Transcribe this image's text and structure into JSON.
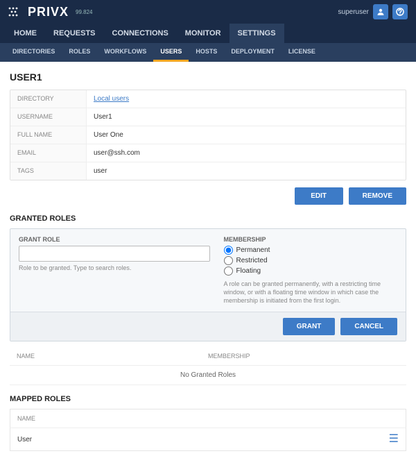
{
  "brand": {
    "name": "PRIVX",
    "version": "99.824"
  },
  "user_menu": {
    "username": "superuser"
  },
  "nav_primary": [
    "HOME",
    "REQUESTS",
    "CONNECTIONS",
    "MONITOR",
    "SETTINGS"
  ],
  "nav_primary_active": 4,
  "nav_secondary": [
    "DIRECTORIES",
    "ROLES",
    "WORKFLOWS",
    "USERS",
    "HOSTS",
    "DEPLOYMENT",
    "LICENSE"
  ],
  "nav_secondary_active": 3,
  "page_title": "USER1",
  "details": {
    "labels": {
      "directory": "DIRECTORY",
      "username": "USERNAME",
      "fullname": "FULL NAME",
      "email": "EMAIL",
      "tags": "TAGS"
    },
    "values": {
      "directory": "Local users",
      "username": "User1",
      "fullname": "User One",
      "email": "user@ssh.com",
      "tags": "user"
    }
  },
  "buttons": {
    "edit": "EDIT",
    "remove": "REMOVE",
    "grant": "GRANT",
    "cancel": "CANCEL"
  },
  "granted_roles": {
    "heading": "GRANTED ROLES",
    "grant_role_label": "GRANT ROLE",
    "grant_role_help": "Role to be granted. Type to search roles.",
    "membership_label": "MEMBERSHIP",
    "membership_options": [
      "Permanent",
      "Restricted",
      "Floating"
    ],
    "membership_selected": 0,
    "membership_desc": "A role can be granted permanently, with a restricting time window, or with a floating time window in which case the membership is initiated from the first login.",
    "table": {
      "col_name": "NAME",
      "col_membership": "MEMBERSHIP",
      "empty": "No Granted Roles"
    }
  },
  "mapped_roles": {
    "heading": "MAPPED ROLES",
    "col_name": "NAME",
    "rows": [
      {
        "name": "User"
      }
    ]
  }
}
